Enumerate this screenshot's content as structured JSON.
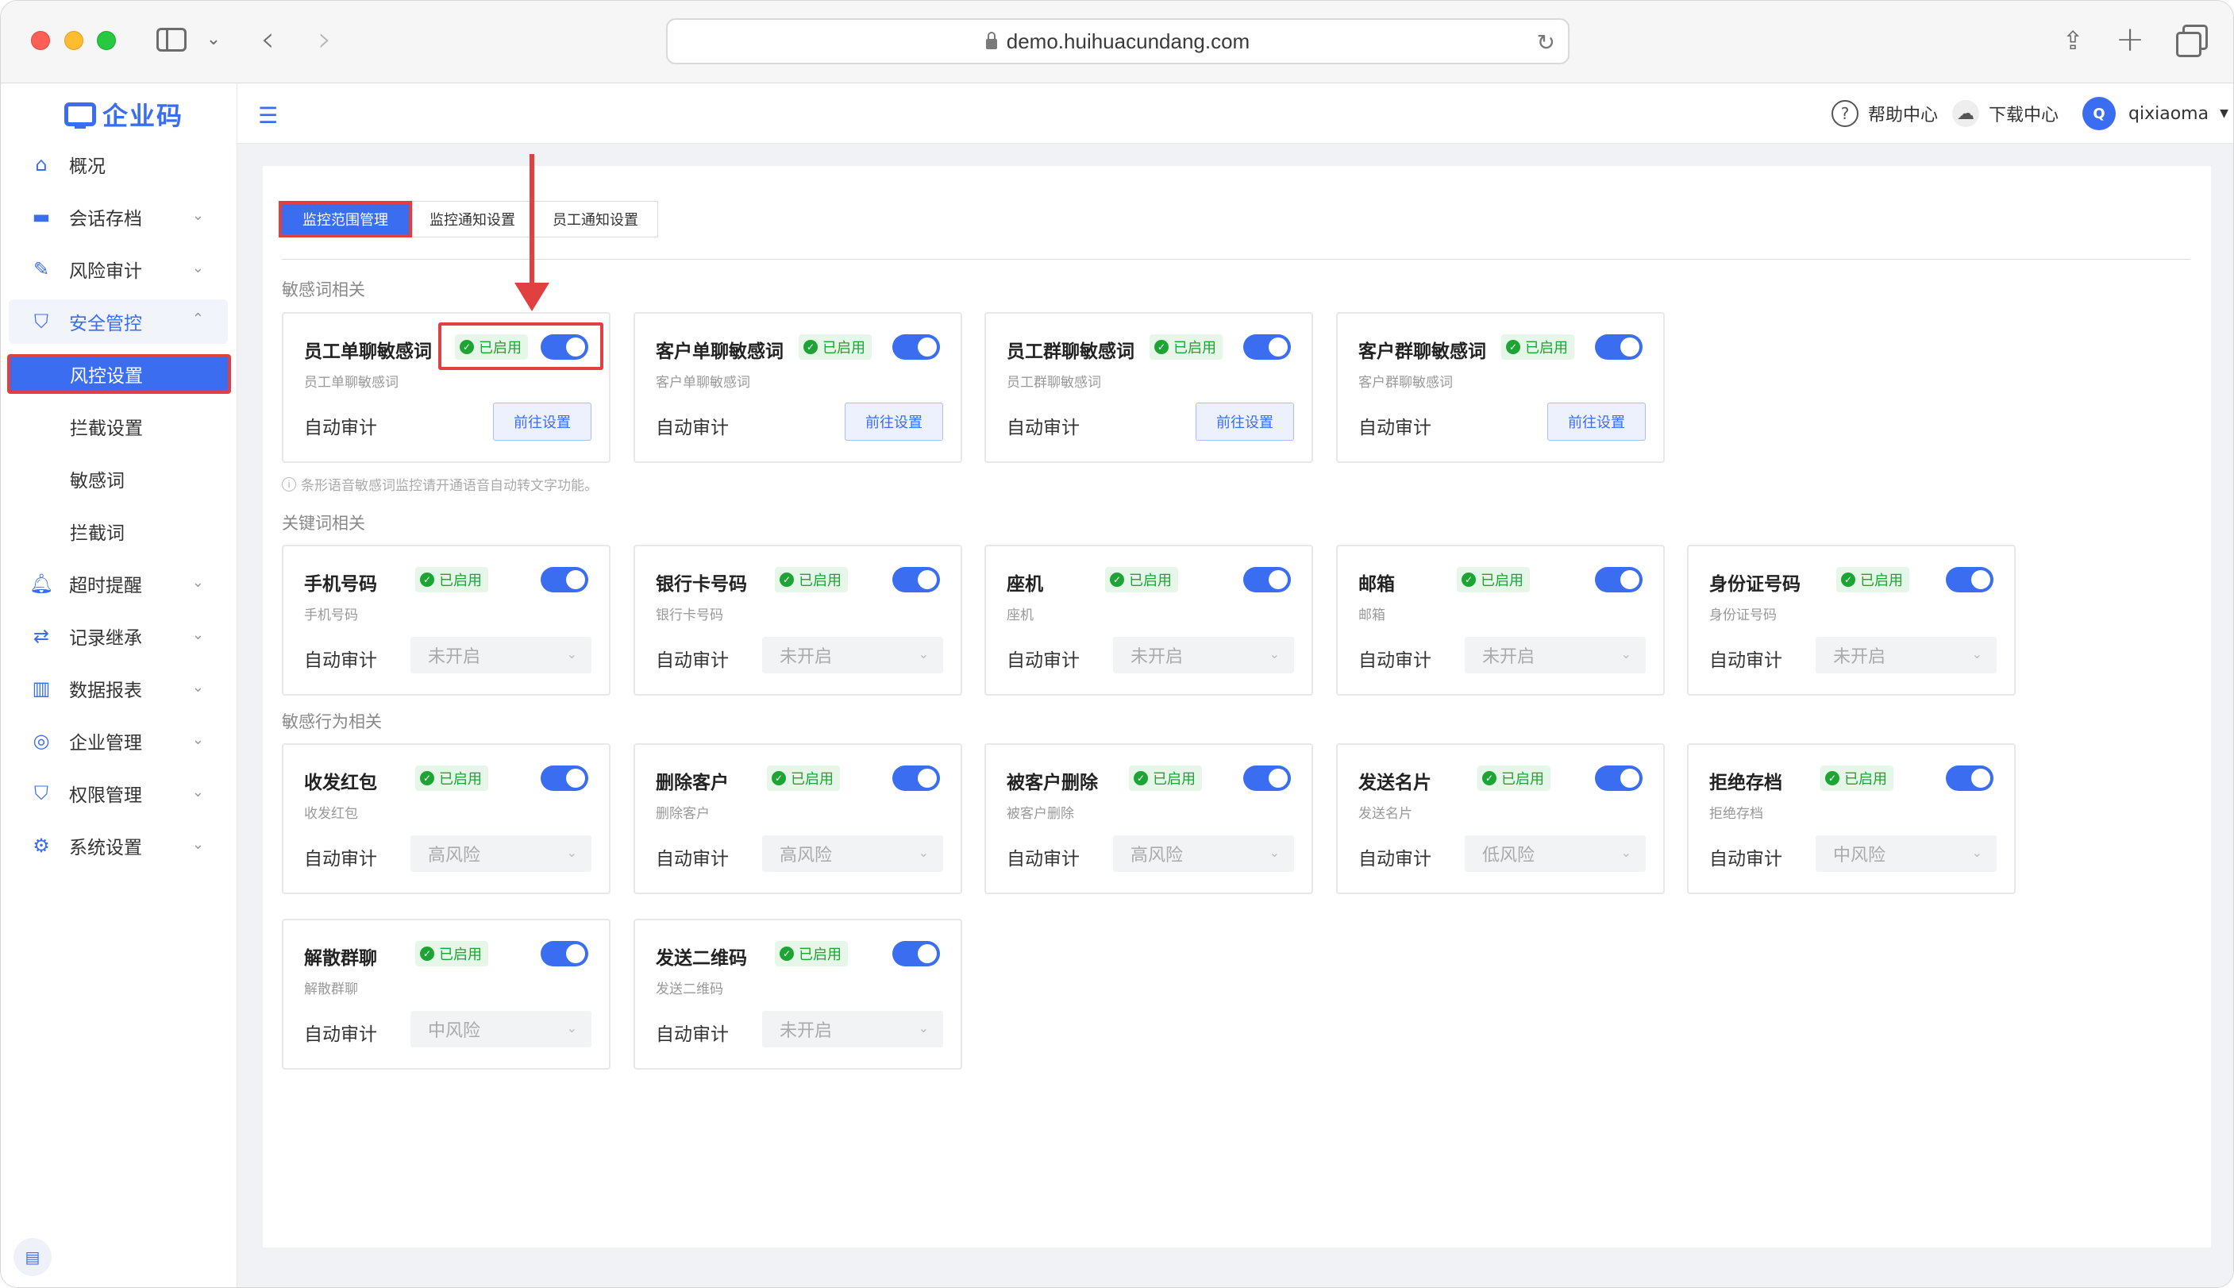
{
  "browser": {
    "url": "demo.huihuacundang.com"
  },
  "app": {
    "logo_text": "企业码"
  },
  "sidebar": {
    "items": [
      {
        "label": "概况",
        "icon": "home-icon"
      },
      {
        "label": "会话存档",
        "icon": "folder-icon"
      },
      {
        "label": "风险审计",
        "icon": "edit-icon"
      },
      {
        "label": "安全管控",
        "icon": "shield-icon"
      },
      {
        "label": "超时提醒",
        "icon": "bell-icon"
      },
      {
        "label": "记录继承",
        "icon": "transfer-icon"
      },
      {
        "label": "数据报表",
        "icon": "chart-icon"
      },
      {
        "label": "企业管理",
        "icon": "enterprise-icon"
      },
      {
        "label": "权限管理",
        "icon": "shield-icon"
      },
      {
        "label": "系统设置",
        "icon": "gear-icon"
      }
    ],
    "sub_items": [
      "风控设置",
      "拦截设置",
      "敏感词",
      "拦截词"
    ]
  },
  "header": {
    "help": "帮助中心",
    "download": "下载中心",
    "username": "qixiaoma",
    "avatar_letter": "Q"
  },
  "tabs": [
    "监控范围管理",
    "监控通知设置",
    "员工通知设置"
  ],
  "common": {
    "enabled": "已启用",
    "auto_audit": "自动审计",
    "goto": "前往设置"
  },
  "sections": {
    "sensitive": "敏感词相关",
    "keyword": "关键词相关",
    "behavior": "敏感行为相关",
    "hint": "条形语音敏感词监控请开通语音自动转文字功能。"
  },
  "sensitive_cards": [
    {
      "title": "员工单聊敏感词",
      "sub": "员工单聊敏感词"
    },
    {
      "title": "客户单聊敏感词",
      "sub": "客户单聊敏感词"
    },
    {
      "title": "员工群聊敏感词",
      "sub": "员工群聊敏感词"
    },
    {
      "title": "客户群聊敏感词",
      "sub": "客户群聊敏感词"
    }
  ],
  "keyword_cards": [
    {
      "title": "手机号码",
      "sub": "手机号码",
      "value": "未开启"
    },
    {
      "title": "银行卡号码",
      "sub": "银行卡号码",
      "value": "未开启"
    },
    {
      "title": "座机",
      "sub": "座机",
      "value": "未开启"
    },
    {
      "title": "邮箱",
      "sub": "邮箱",
      "value": "未开启"
    },
    {
      "title": "身份证号码",
      "sub": "身份证号码",
      "value": "未开启"
    }
  ],
  "behavior_cards": [
    {
      "title": "收发红包",
      "sub": "收发红包",
      "value": "高风险"
    },
    {
      "title": "删除客户",
      "sub": "删除客户",
      "value": "高风险"
    },
    {
      "title": "被客户删除",
      "sub": "被客户删除",
      "value": "高风险"
    },
    {
      "title": "发送名片",
      "sub": "发送名片",
      "value": "低风险"
    },
    {
      "title": "拒绝存档",
      "sub": "拒绝存档",
      "value": "中风险"
    },
    {
      "title": "解散群聊",
      "sub": "解散群聊",
      "value": "中风险"
    },
    {
      "title": "发送二维码",
      "sub": "发送二维码",
      "value": "未开启"
    }
  ]
}
